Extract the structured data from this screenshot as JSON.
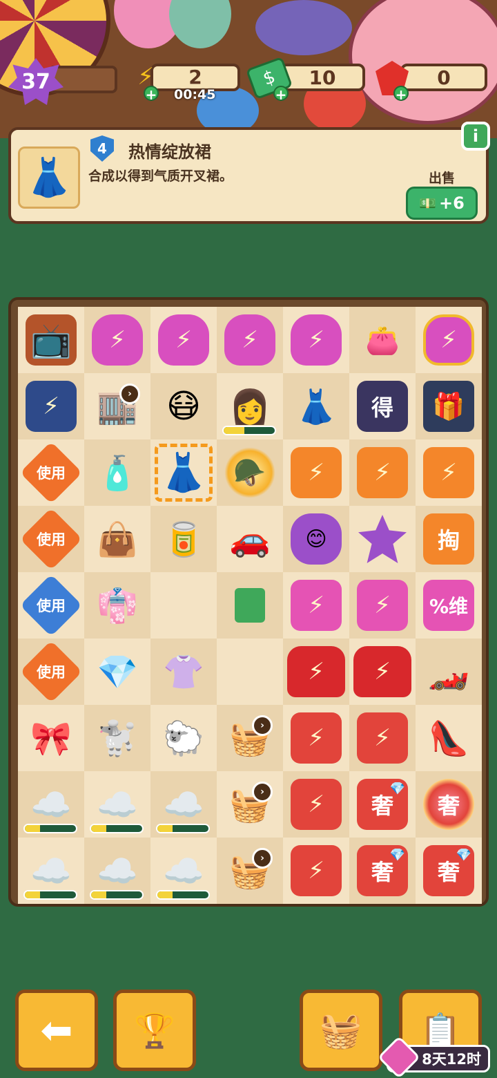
{
  "hud": {
    "level": "37",
    "energy": "2",
    "energy_timer": "00:45",
    "cash": "10",
    "gems": "0"
  },
  "info_panel": {
    "tier": "4",
    "title": "热情绽放裙",
    "description": "合成以得到气质开叉裙。",
    "sell_label": "出售",
    "sell_value": "+6",
    "info_icon": "i"
  },
  "board": {
    "labels": {
      "use": "使用",
      "de": "得",
      "tao": "掏",
      "wei": "%维",
      "she": "奢"
    }
  },
  "bottom": {
    "event_time": "8天12时"
  },
  "icons": [
    "energy-bolt-icon",
    "cash-icon",
    "gem-icon",
    "info-icon",
    "back-arrow-icon",
    "podium-icon",
    "basket-icon",
    "clipboard-star-icon"
  ]
}
